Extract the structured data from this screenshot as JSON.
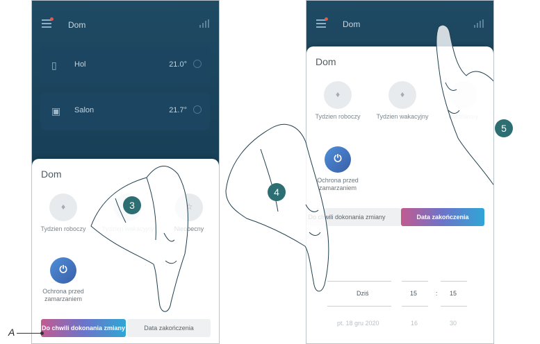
{
  "phone1": {
    "header_title": "Dom",
    "rooms": [
      {
        "name": "Hol",
        "temp": "21.0°"
      },
      {
        "name": "Salon",
        "temp": "21.7°"
      }
    ],
    "sheet_title": "Dom",
    "modes": [
      {
        "label": "Tydzien roboczy"
      },
      {
        "label": "Tydzien wakacyjny"
      },
      {
        "label": "Nieobecny"
      }
    ],
    "frost_label": "Ochrona przed zamarzaniem",
    "seg_until_change": "Do chwili dokonania zmiany",
    "seg_end_date": "Data zakończenia",
    "step": "3",
    "callout": "A"
  },
  "phone2": {
    "header_title": "Dom",
    "sheet_title": "Dom",
    "modes": [
      {
        "label": "Tydzien roboczy"
      },
      {
        "label": "Tydzien wakacyjny"
      },
      {
        "label": "Nieobecny"
      }
    ],
    "frost_label": "Ochrona przed zamarzaniem",
    "seg_until_change": "Do chwili dokonania zmiany",
    "seg_end_date": "Data zakończenia",
    "picker": {
      "date_selected": "Dziś",
      "hour_selected": "15",
      "separator": ":",
      "minute_selected": "15",
      "date_next": "pt. 18 gru 2020",
      "hour_next": "16",
      "minute_next": "30"
    },
    "steps": [
      "4",
      "5"
    ]
  },
  "colors": {
    "header_bg": "#1f4a63",
    "badge": "#2d6e73",
    "gradient_start": "#c25a90",
    "gradient_end": "#2fa6d5"
  }
}
